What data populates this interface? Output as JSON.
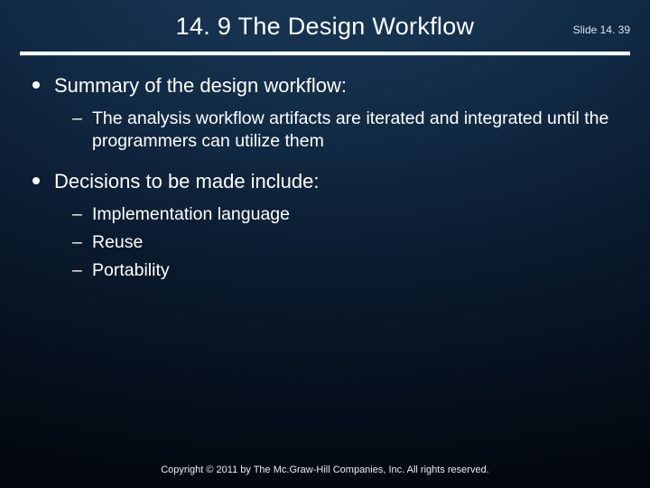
{
  "header": {
    "title": "14. 9  The Design Workflow",
    "slide_number": "Slide 14. 39"
  },
  "body": {
    "items": [
      {
        "text": "Summary of the design workflow:",
        "sub": [
          "The analysis workflow artifacts are iterated and integrated until the programmers can utilize them"
        ]
      },
      {
        "text": "Decisions to be made include:",
        "sub": [
          "Implementation language",
          "Reuse",
          "Portability"
        ]
      }
    ]
  },
  "footer": {
    "copyright": "Copyright © 2011 by The Mc.Graw-Hill Companies, Inc.  All rights reserved."
  }
}
